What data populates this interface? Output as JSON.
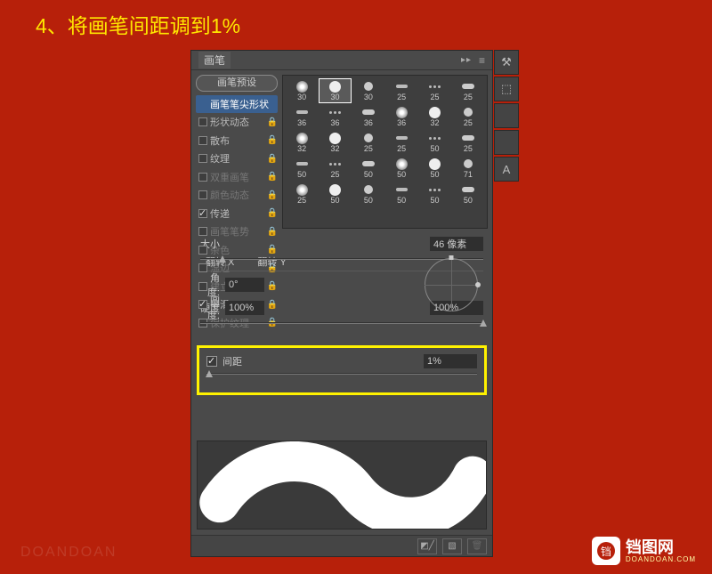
{
  "instruction": "4、将画笔间距调到1%",
  "panel": {
    "title_tab": "画笔",
    "adv_icon": "▸▸",
    "menu_icon": "≡"
  },
  "sidebar": {
    "preset_button": "画笔预设",
    "items": [
      {
        "label": "画笔笔尖形状",
        "active": true,
        "checkbox": null,
        "locked": false,
        "dim": false
      },
      {
        "label": "形状动态",
        "active": false,
        "checkbox": false,
        "locked": true,
        "dim": false
      },
      {
        "label": "散布",
        "active": false,
        "checkbox": false,
        "locked": true,
        "dim": false
      },
      {
        "label": "纹理",
        "active": false,
        "checkbox": false,
        "locked": true,
        "dim": false
      },
      {
        "label": "双重画笔",
        "active": false,
        "checkbox": false,
        "locked": true,
        "dim": true
      },
      {
        "label": "颜色动态",
        "active": false,
        "checkbox": false,
        "locked": true,
        "dim": true
      },
      {
        "label": "传递",
        "active": false,
        "checkbox": true,
        "locked": true,
        "dim": false
      },
      {
        "label": "画笔笔势",
        "active": false,
        "checkbox": false,
        "locked": true,
        "dim": true
      },
      {
        "label": "杂色",
        "active": false,
        "checkbox": false,
        "locked": true,
        "dim": true
      },
      {
        "label": "湿边",
        "active": false,
        "checkbox": false,
        "locked": true,
        "dim": true
      },
      {
        "label": "建立",
        "active": false,
        "checkbox": false,
        "locked": true,
        "dim": true
      },
      {
        "label": "平滑",
        "active": false,
        "checkbox": true,
        "locked": true,
        "dim": false
      },
      {
        "label": "保护纹理",
        "active": false,
        "checkbox": false,
        "locked": true,
        "dim": true
      }
    ]
  },
  "swatches": {
    "rows": [
      [
        "30",
        "30",
        "30",
        "25",
        "25",
        "25"
      ],
      [
        "36",
        "36",
        "36",
        "36",
        "32",
        "25"
      ],
      [
        "32",
        "32",
        "25",
        "25",
        "50",
        "25"
      ],
      [
        "50",
        "25",
        "50",
        "50",
        "50",
        "71"
      ],
      [
        "25",
        "50",
        "50",
        "50",
        "50",
        "50"
      ]
    ],
    "selected": [
      0,
      1
    ]
  },
  "controls": {
    "size_label": "大小",
    "size_value": "46 像素",
    "flip_x_label": "翻转 X",
    "flip_y_label": "翻转 Y",
    "flip_x": false,
    "flip_y": false,
    "angle_label": "角度:",
    "angle_value": "0°",
    "round_label": "圆度:",
    "round_value": "100%",
    "hard_label": "硬度",
    "hard_value": "100%",
    "spacing_label": "间距",
    "spacing_checked": true,
    "spacing_value": "1%"
  },
  "watermark": {
    "left": "DOANDOAN",
    "brand_cn": "铛图网",
    "brand_en": "DOANDOAN.COM"
  },
  "rail": [
    "⚒",
    "⬚",
    "",
    "",
    "A"
  ]
}
